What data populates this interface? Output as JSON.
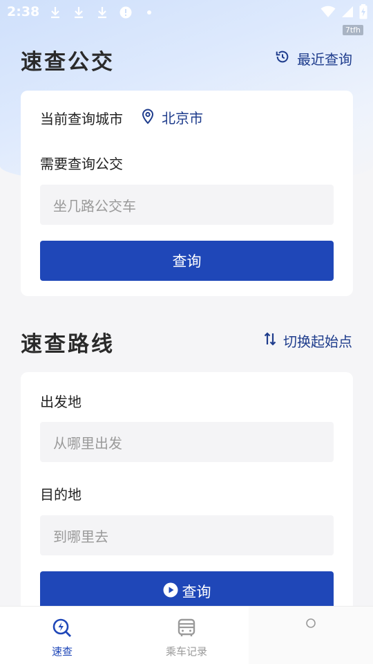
{
  "status_bar": {
    "time": "2:38",
    "badge": "7tfh"
  },
  "bus_search": {
    "title": "速查公交",
    "recent_label": "最近查询",
    "city_label": "当前查询城市",
    "city_value": "北京市",
    "bus_label": "需要查询公交",
    "bus_placeholder": "坐几路公交车",
    "query_button": "查询"
  },
  "route_search": {
    "title": "速查路线",
    "switch_label": "切换起始点",
    "from_label": "出发地",
    "from_placeholder": "从哪里出发",
    "to_label": "目的地",
    "to_placeholder": "到哪里去",
    "query_button": "查询"
  },
  "tabbar": {
    "items": [
      {
        "label": "速查",
        "icon": "search-bolt-icon",
        "active": true
      },
      {
        "label": "乘车记录",
        "icon": "bus-icon",
        "active": false
      },
      {
        "label": "",
        "icon": "circle-icon",
        "active": false
      }
    ]
  },
  "colors": {
    "accent": "#1f47b8",
    "link": "#1e3c8c",
    "inactive": "#9a9a9a"
  }
}
